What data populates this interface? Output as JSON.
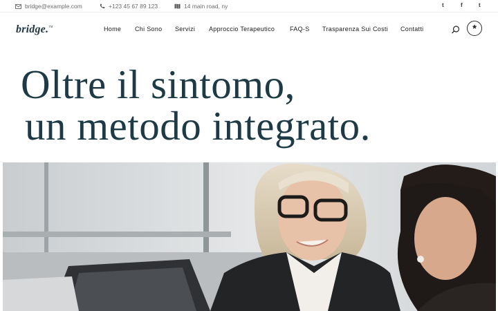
{
  "topbar": {
    "email": "bridge@example.com",
    "phone": "+123 45 67 89 123",
    "address": "14 main road, ny",
    "social": [
      {
        "icon": "twitter-icon",
        "label": "t"
      },
      {
        "icon": "facebook-icon",
        "label": "f"
      },
      {
        "icon": "tumblr-icon",
        "label": "t"
      }
    ]
  },
  "header": {
    "logo": "bridge.",
    "logo_tm": "TM",
    "nav": [
      "Home",
      "Chi Sono",
      "Servizi",
      "Approccio Terapeutico",
      "FAQ-S",
      "Trasparenza Sui Costi",
      "Contatti"
    ],
    "menu_button": "*"
  },
  "hero": {
    "line1": "Oltre il sintomo,",
    "line2": "un metodo integrato."
  },
  "colors": {
    "headline": "#1e3a44",
    "logo": "#243845"
  }
}
